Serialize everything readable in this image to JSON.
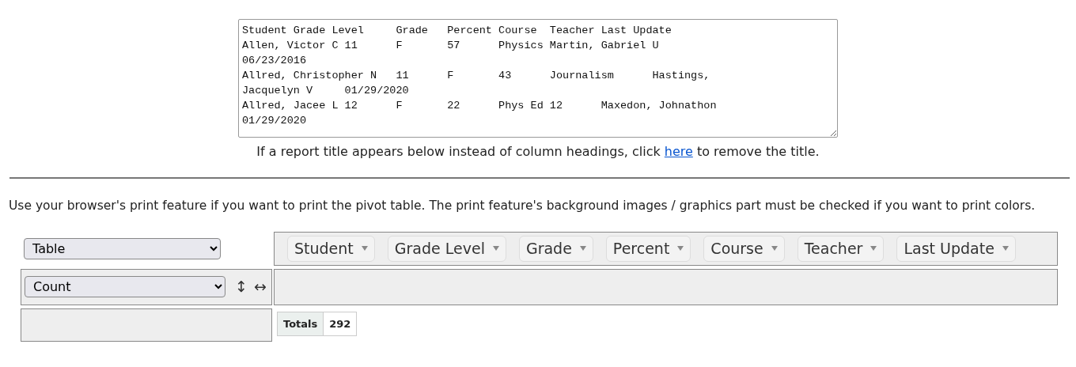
{
  "data_textarea": {
    "lines": [
      "Student Grade Level     Grade   Percent Course  Teacher Last Update",
      "Allen, Victor C 11      F       57      Physics Martin, Gabriel U",
      "06/23/2016",
      "Allred, Christopher N   11      F       43      Journalism      Hastings,",
      "Jacquelyn V     01/29/2020",
      "Allred, Jacee L 12      F       22      Phys Ed 12      Maxedon, Johnathon",
      "01/29/2020"
    ]
  },
  "notice": {
    "before": "If a report title appears below instead of column headings, click",
    "link": "here",
    "after": "to remove the title."
  },
  "print_note": "Use your browser's print feature if you want to print the pivot table. The print feature's background images / graphics part must be checked if you want to print colors.",
  "pivot": {
    "renderer_select": {
      "value": "Table"
    },
    "aggregator_select": {
      "value": "Count"
    },
    "row_order_symbol": "↕",
    "col_order_symbol": "↔",
    "fields": [
      "Student",
      "Grade Level",
      "Grade",
      "Percent",
      "Course",
      "Teacher",
      "Last Update"
    ],
    "totals": {
      "label": "Totals",
      "value": "292"
    }
  }
}
